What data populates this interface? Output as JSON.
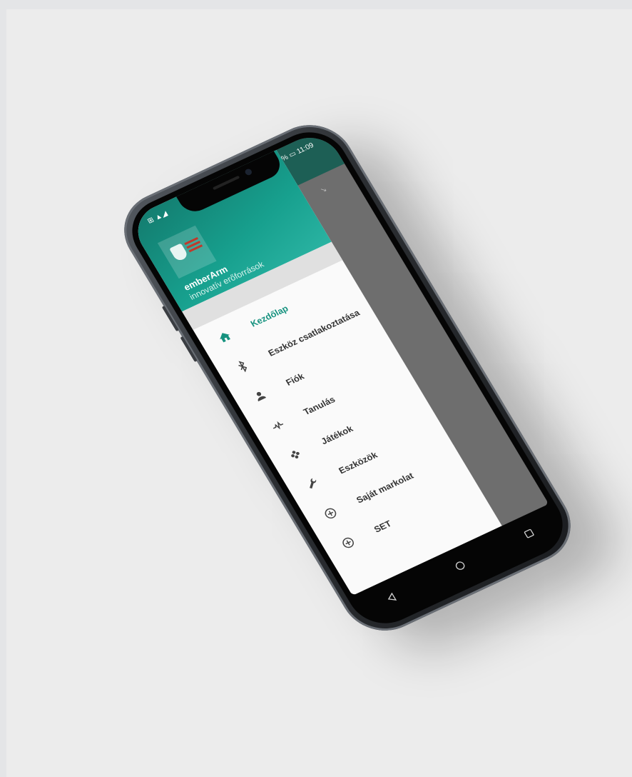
{
  "status": {
    "left": "⊞ ▲◢",
    "right": "% ▭ 11:09"
  },
  "drawer": {
    "app_name": "emberArm",
    "app_subtitle": "innovatív erőforrások",
    "items": [
      {
        "label": "Kezdőlap",
        "icon": "home-icon",
        "active": true
      },
      {
        "label": "Eszköz csatlakoztatása",
        "icon": "bluetooth-icon",
        "active": false
      },
      {
        "label": "Fiók",
        "icon": "person-icon",
        "active": false
      },
      {
        "label": "Tanulás",
        "icon": "signal-icon",
        "active": false
      },
      {
        "label": "Játékok",
        "icon": "joystick-icon",
        "active": false
      },
      {
        "label": "Eszközök",
        "icon": "wrench-icon",
        "active": false
      },
      {
        "label": "Saját markolat",
        "icon": "add-circle-icon",
        "active": false
      },
      {
        "label": "SET",
        "icon": "add-circle-icon",
        "active": false
      }
    ]
  },
  "colors": {
    "accent": "#16927f",
    "header": "#17a08e",
    "appbar": "#1d5f55"
  }
}
